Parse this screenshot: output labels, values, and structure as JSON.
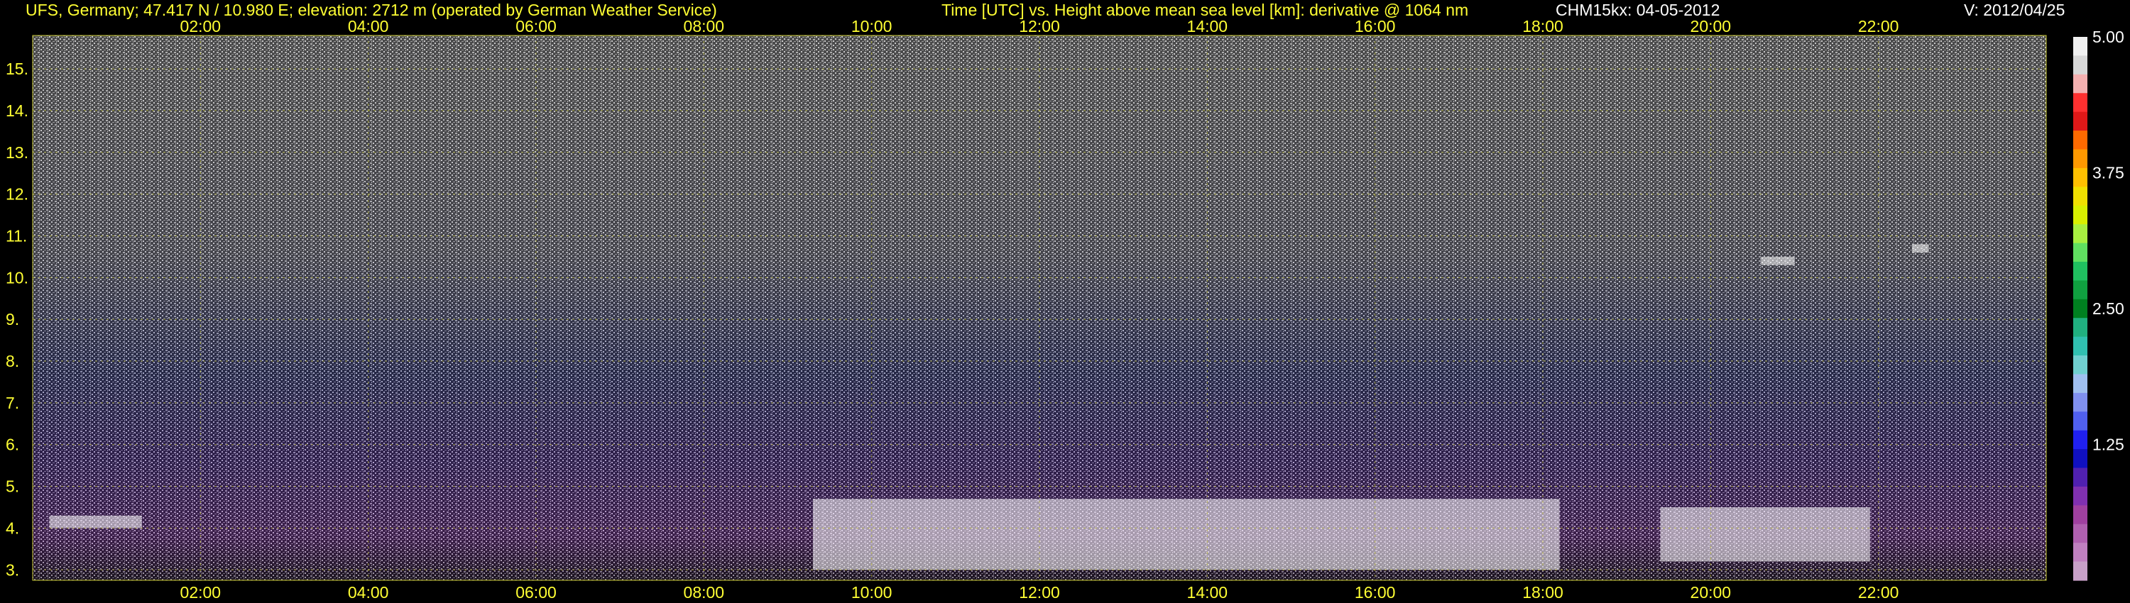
{
  "header": {
    "station": "UFS, Germany; 47.417 N / 10.980 E; elevation: 2712 m  (operated by German Weather Service)",
    "axes_title": "Time [UTC] vs. Height above mean sea level [km]: derivative @ 1064 nm",
    "instrument_date": "CHM15kx: 04-05-2012",
    "version": "V: 2012/04/25"
  },
  "colors": {
    "annotation": "#ffff33",
    "grid": "#c8c832",
    "background": "#000000",
    "noise_light": "#d8d8d8",
    "aerosol_purple": "#6a2a9a",
    "aerosol_blue": "#3040b0",
    "cloud": "#ffffff"
  },
  "chart_data": {
    "type": "heatmap",
    "title": "Time [UTC] vs. Height above mean sea level [km]: derivative @ 1064 nm",
    "xlabel": "Time [UTC]",
    "ylabel": "Height above mean sea level [km]",
    "x_range_hours": [
      0,
      24
    ],
    "x_ticks": [
      "02:00",
      "04:00",
      "06:00",
      "08:00",
      "10:00",
      "12:00",
      "14:00",
      "16:00",
      "18:00",
      "20:00",
      "22:00"
    ],
    "x_tick_hours": [
      2,
      4,
      6,
      8,
      10,
      12,
      14,
      16,
      18,
      20,
      22
    ],
    "y_range_km": [
      2.75,
      15.8
    ],
    "y_ticks": [
      "3.",
      "4.",
      "5.",
      "6.",
      "7.",
      "8.",
      "9.",
      "10.",
      "11.",
      "12.",
      "13.",
      "14.",
      "15."
    ],
    "y_tick_km": [
      3,
      4,
      5,
      6,
      7,
      8,
      9,
      10,
      11,
      12,
      13,
      14,
      15
    ],
    "grid": true,
    "colorbar": {
      "range": [
        0,
        5.0
      ],
      "labels": [
        "5.00",
        "3.75",
        "2.50",
        "1.25"
      ],
      "label_values": [
        5.0,
        3.75,
        2.5,
        1.25
      ],
      "colors": [
        "#f0f0f0",
        "#d8d8d8",
        "#f4b0b0",
        "#ff3030",
        "#e01818",
        "#ff6a00",
        "#ff9900",
        "#ffc000",
        "#f0e000",
        "#d8f000",
        "#a8f040",
        "#60e060",
        "#20c060",
        "#10a040",
        "#008020",
        "#20b080",
        "#30c0b0",
        "#70d0d0",
        "#a0c0f0",
        "#8090f0",
        "#5060f0",
        "#2020f0",
        "#1010c0",
        "#5020b0",
        "#8030b0",
        "#a040a0",
        "#b060b0",
        "#c080c0",
        "#c8a0c8"
      ]
    },
    "cloud_layers": [
      {
        "start_h": 0.2,
        "end_h": 1.3,
        "top_km": 4.3,
        "base_km": 4.0
      },
      {
        "start_h": 9.3,
        "end_h": 18.2,
        "top_km": 4.7,
        "base_km": 3.0
      },
      {
        "start_h": 19.4,
        "end_h": 21.9,
        "top_km": 4.5,
        "base_km": 3.2
      },
      {
        "start_h": 20.6,
        "end_h": 21.0,
        "top_km": 10.5,
        "base_km": 10.3
      },
      {
        "start_h": 22.4,
        "end_h": 22.6,
        "top_km": 10.8,
        "base_km": 10.6
      }
    ]
  }
}
